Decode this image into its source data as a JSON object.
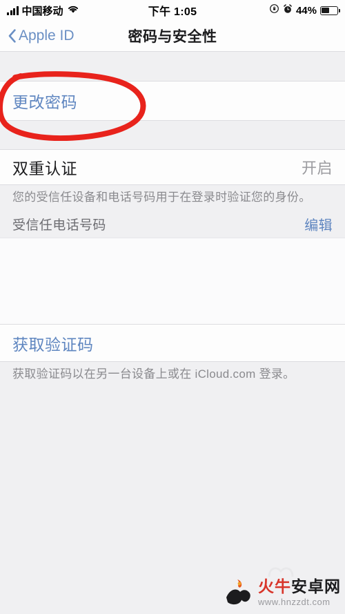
{
  "status_bar": {
    "carrier": "中国移动",
    "signal_bars": 4,
    "wifi_icon": "wifi-icon",
    "time": "下午 1:05",
    "rotation_lock_icon": "rotation-lock-icon",
    "alarm_icon": "alarm-clock-icon",
    "battery_percent": "44%",
    "battery_level": 44
  },
  "nav_bar": {
    "back_label": "Apple ID",
    "back_icon": "chevron-left-icon",
    "title": "密码与安全性"
  },
  "sections": {
    "password": {
      "change_password_label": "更改密码"
    },
    "two_factor": {
      "label": "双重认证",
      "value": "开启",
      "footer": "您的受信任设备和电话号码用于在登录时验证您的身份。",
      "trusted_number_label": "受信任电话号码",
      "edit_label": "编辑"
    },
    "verification_code": {
      "label": "获取验证码",
      "footer": "获取验证码以在另一台设备上或在 iCloud.com 登录。"
    }
  },
  "annotation": {
    "shape": "red-hand-drawn-circle",
    "target": "更改密码",
    "color": "#e8231c"
  },
  "watermark": {
    "logo_icon": "bull-torch-logo-icon",
    "title_red": "火牛",
    "title_black": "安卓网",
    "url": "www.hnzzdt.com"
  },
  "colors": {
    "accent_blue": "#5f86c0",
    "background_gray": "#f0f0f2",
    "row_white": "#fdfdfd",
    "separator": "#dcdce0",
    "secondary_text": "#8a8a8e",
    "annotation_red": "#e8231c"
  }
}
